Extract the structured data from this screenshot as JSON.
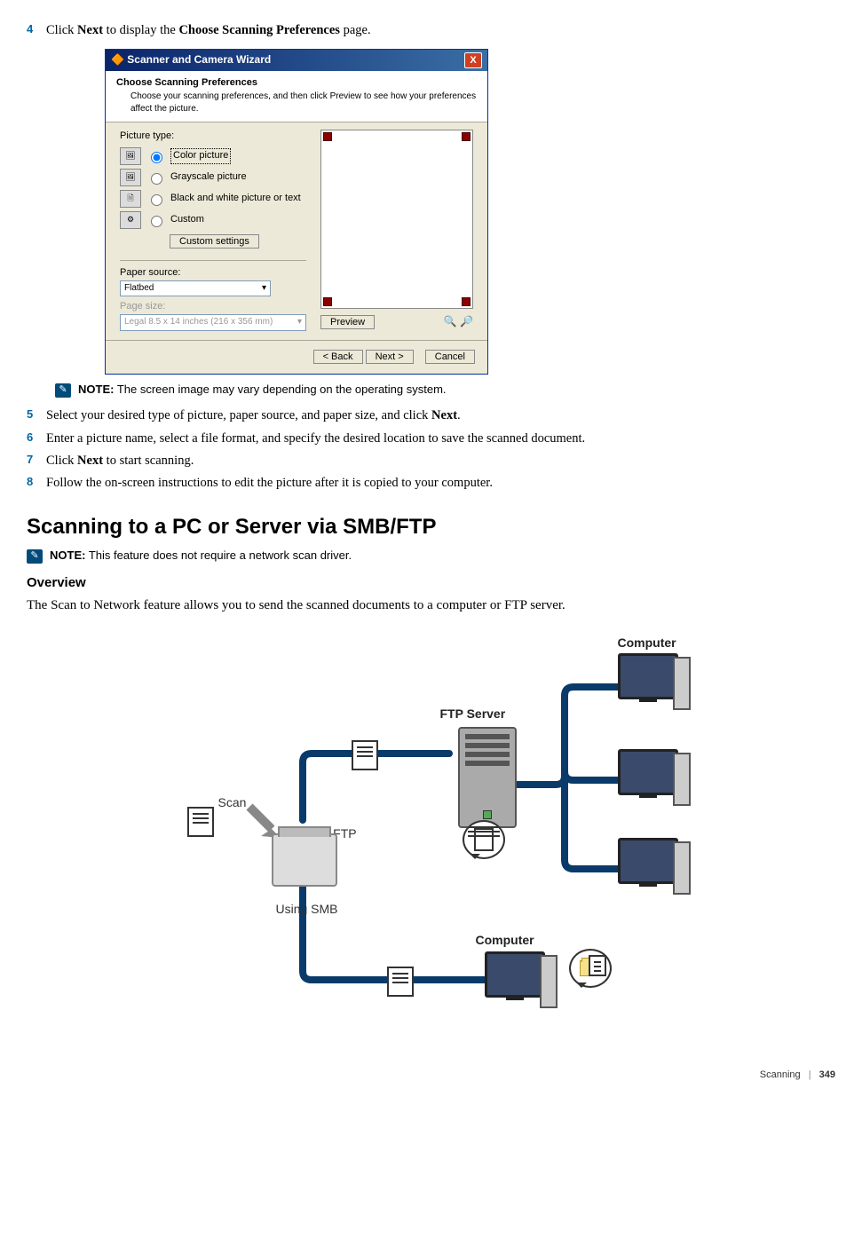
{
  "steps": {
    "s4": {
      "num": "4",
      "pre": "Click ",
      "b1": "Next",
      "mid": " to display the ",
      "b2": "Choose Scanning Preferences",
      "post": " page."
    },
    "s5": {
      "num": "5",
      "pre": "Select your desired type of picture, paper source, and paper size, and click ",
      "b1": "Next",
      "post": "."
    },
    "s6": {
      "num": "6",
      "text": "Enter a picture name, select a file format, and specify the desired location to save the scanned document."
    },
    "s7": {
      "num": "7",
      "pre": "Click ",
      "b1": "Next",
      "post": " to start scanning."
    },
    "s8": {
      "num": "8",
      "text": "Follow the on-screen instructions to edit the picture after it is copied to your computer."
    }
  },
  "wizard": {
    "title": "Scanner and Camera Wizard",
    "head_title": "Choose Scanning Preferences",
    "head_sub": "Choose your scanning preferences, and then click Preview to see how your preferences affect the picture.",
    "pic_type_label": "Picture type:",
    "opt_color": "Color picture",
    "opt_gray": "Grayscale picture",
    "opt_bw": "Black and white picture or text",
    "opt_custom": "Custom",
    "custom_btn": "Custom settings",
    "paper_source_label": "Paper source:",
    "paper_source_value": "Flatbed",
    "page_size_label": "Page size:",
    "page_size_value": "Legal 8.5 x 14 inches (216 x 356 mm)",
    "preview_btn": "Preview",
    "back_btn": "< Back",
    "next_btn": "Next >",
    "cancel_btn": "Cancel"
  },
  "notes": {
    "note1": {
      "label": "NOTE:",
      "text": " The screen image may vary depending on the operating system."
    },
    "note2": {
      "label": "NOTE:",
      "text": " This feature does not require a network scan driver."
    }
  },
  "section_title": "Scanning to a PC or Server via SMB/FTP",
  "overview_head": "Overview",
  "overview_text": "The Scan to Network feature allows you to send the scanned documents to a computer or FTP server.",
  "diagram": {
    "computer_top": "Computer",
    "ftp_server": "FTP Server",
    "scan": "Scan",
    "using_ftp": "Using FTP",
    "using_smb": "Using SMB",
    "computer_bottom": "Computer"
  },
  "footer": {
    "chapter": "Scanning",
    "page": "349"
  }
}
